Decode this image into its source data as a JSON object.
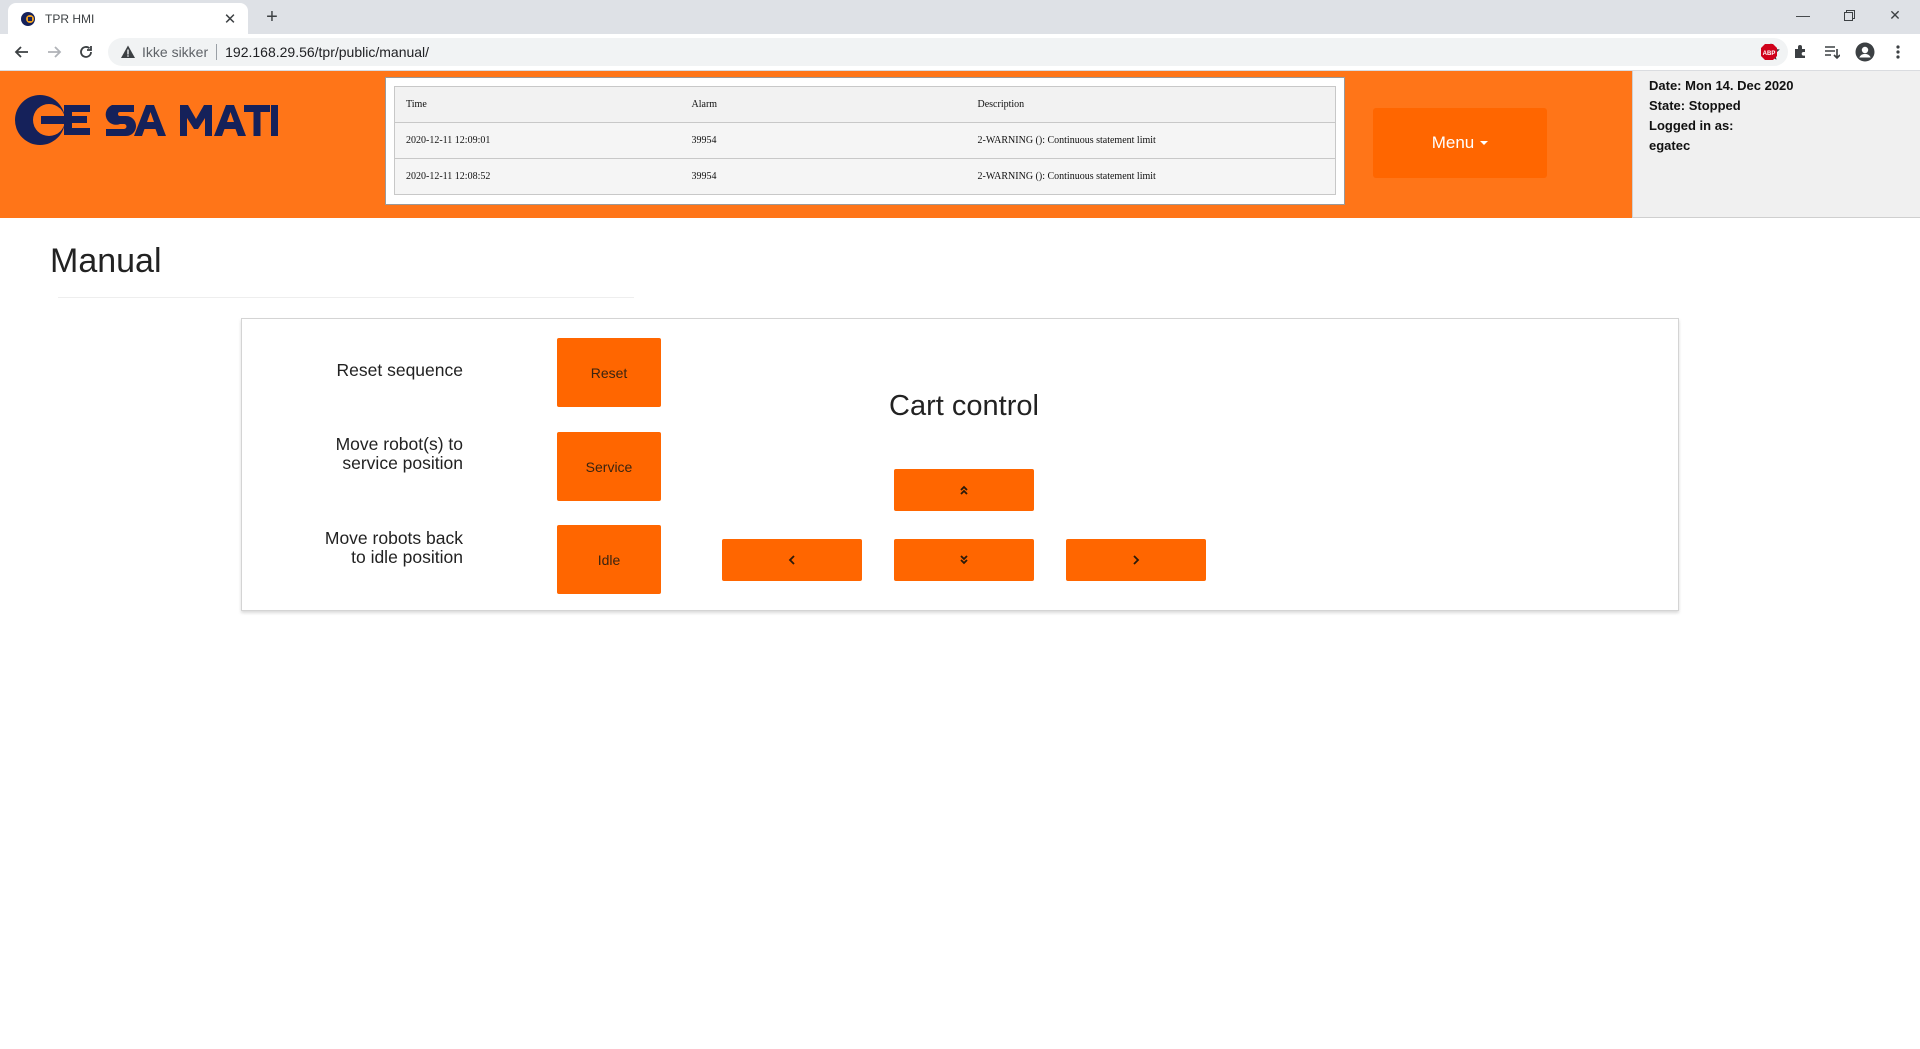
{
  "browser": {
    "tab_title": "TPR HMI",
    "insecure_label": "Ikke sikker",
    "url": "192.168.29.56/tpr/public/manual/"
  },
  "header": {
    "logo_text": "EGA MATIC",
    "alarms": {
      "columns": [
        "Time",
        "Alarm",
        "Description"
      ],
      "rows": [
        {
          "time": "2020-12-11 12:09:01",
          "alarm": "39954",
          "description": "2-WARNING (): Continuous statement limit"
        },
        {
          "time": "2020-12-11 12:08:52",
          "alarm": "39954",
          "description": "2-WARNING (): Continuous statement limit"
        }
      ]
    },
    "menu_label": "Menu",
    "status": {
      "date": "Date: Mon 14. Dec 2020",
      "state": "State: Stopped",
      "logged_in": "Logged in as:",
      "user": "egatec"
    }
  },
  "page": {
    "title": "Manual",
    "actions": [
      {
        "label_line1": "Reset sequence",
        "label_line2": "",
        "button": "Reset"
      },
      {
        "label_line1": "Move robot(s) to",
        "label_line2": "service position",
        "button": "Service"
      },
      {
        "label_line1": "Move robots back",
        "label_line2": "to idle position",
        "button": "Idle"
      }
    ],
    "cart_control": {
      "title": "Cart control",
      "buttons": [
        "up-double-chevron-icon",
        "left-chevron-icon",
        "down-double-chevron-icon",
        "right-chevron-icon"
      ]
    }
  },
  "colors": {
    "brand_orange": "#ff7518",
    "button_orange": "#ff6600",
    "logo_navy": "#15215a"
  }
}
